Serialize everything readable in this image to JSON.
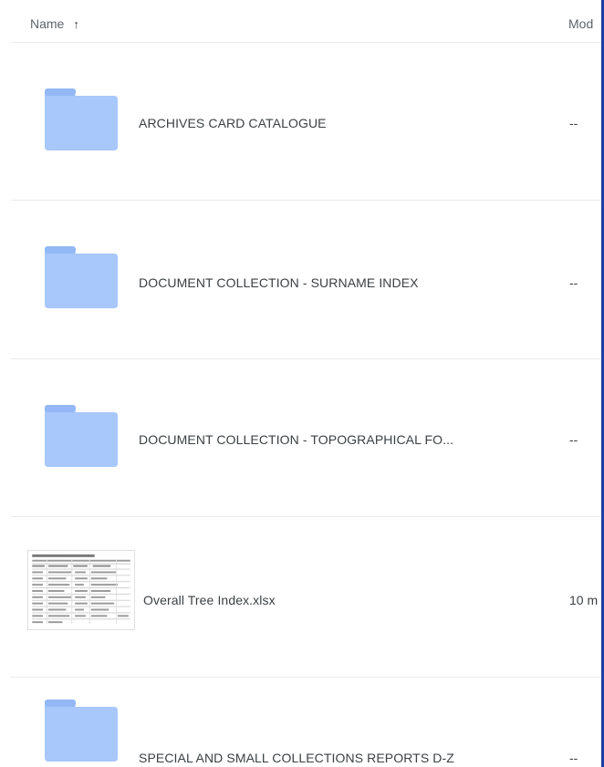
{
  "header": {
    "name_label": "Name",
    "sort_arrow": "↑",
    "modified_label": "Mod"
  },
  "colors": {
    "folder": "#a8c7fa",
    "folder_tab": "#93b8f5",
    "divider": "#e8eaed",
    "right_edge": "#1a3fa3",
    "text": "#3c4043"
  },
  "items": [
    {
      "type": "folder",
      "icon": "folder-icon",
      "name": "ARCHIVES CARD CATALOGUE",
      "modified": "--"
    },
    {
      "type": "folder",
      "icon": "folder-icon",
      "name": "DOCUMENT COLLECTION - SURNAME INDEX",
      "modified": "--"
    },
    {
      "type": "folder",
      "icon": "folder-icon",
      "name": "DOCUMENT COLLECTION - TOPOGRAPHICAL FO...",
      "modified": "--"
    },
    {
      "type": "file",
      "icon": "spreadsheet-thumbnail",
      "name": "Overall Tree Index.xlsx",
      "modified": "10 m"
    },
    {
      "type": "folder",
      "icon": "folder-icon",
      "name": "SPECIAL AND SMALL COLLECTIONS REPORTS D-Z",
      "modified": "--"
    }
  ]
}
